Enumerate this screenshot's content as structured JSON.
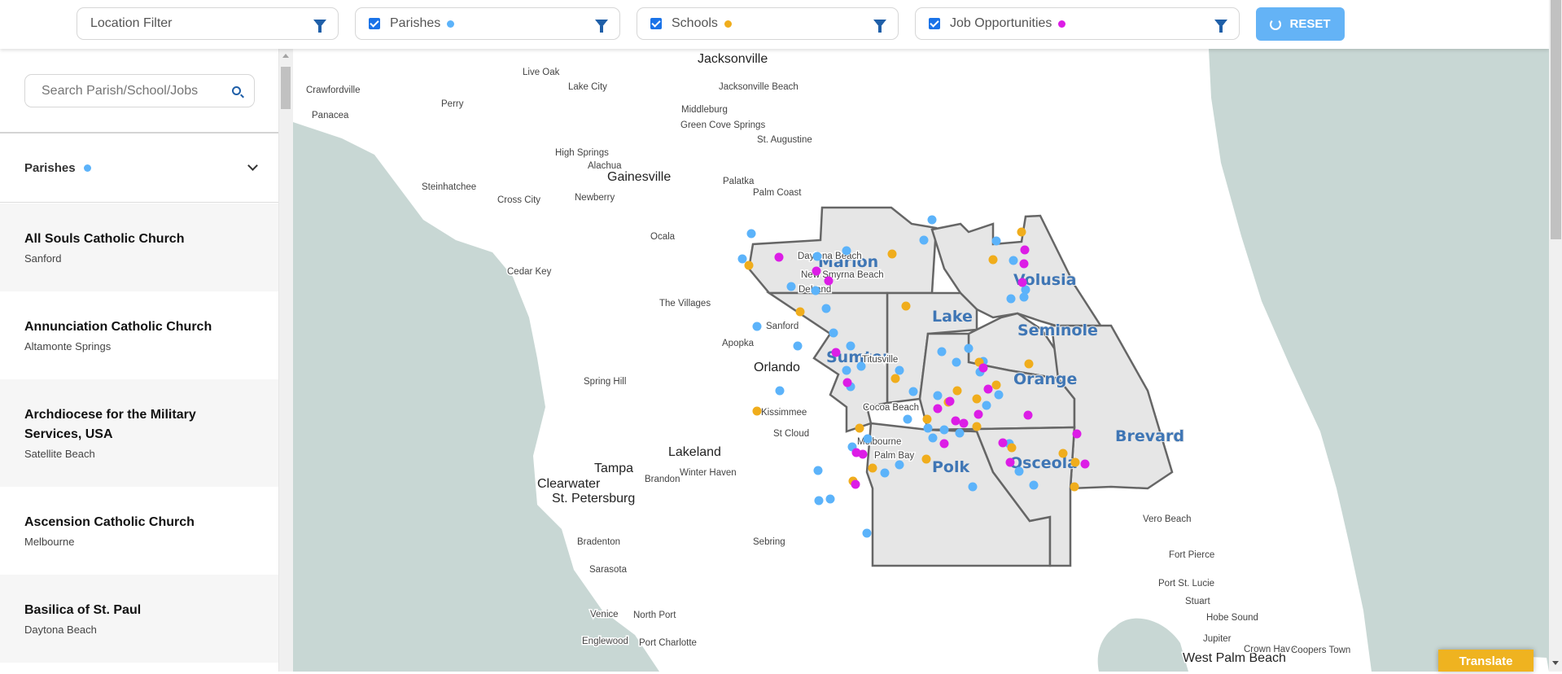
{
  "filters": {
    "location": {
      "label": "Location Filter"
    },
    "parishes": {
      "label": "Parishes",
      "checked": true,
      "color": "#5cb3fa"
    },
    "schools": {
      "label": "Schools",
      "checked": true,
      "color": "#f0ad1c"
    },
    "jobs": {
      "label": "Job Opportunities",
      "checked": true,
      "color": "#dc1de6"
    },
    "reset_label": "RESET"
  },
  "sidebar": {
    "search_placeholder": "Search Parish/School/Jobs",
    "section_title": "Parishes",
    "items": [
      {
        "name": "All Souls Catholic Church",
        "city": "Sanford"
      },
      {
        "name": "Annunciation Catholic Church",
        "city": "Altamonte Springs"
      },
      {
        "name": "Archdiocese for the Military Services, USA",
        "city": "Satellite Beach"
      },
      {
        "name": "Ascension Catholic Church",
        "city": "Melbourne"
      },
      {
        "name": "Basilica of St. Paul",
        "city": "Daytona Beach"
      }
    ]
  },
  "map": {
    "counties": [
      "Marion",
      "Volusia",
      "Lake",
      "Seminole",
      "Sumter",
      "Orange",
      "Brevard",
      "Polk",
      "Osceola"
    ],
    "cities": [
      "Jacksonville",
      "Live Oak",
      "Lake City",
      "Crawfordville",
      "Perry",
      "Panacea",
      "Middleburg",
      "Green Cove Springs",
      "Jacksonville Beach",
      "St. Augustine",
      "High Springs",
      "Alachua",
      "Gainesville",
      "Newberry",
      "Steinhatchee",
      "Cross City",
      "Palatka",
      "Palm Coast",
      "Cedar Key",
      "Ocala",
      "The Villages",
      "Daytona Beach",
      "New Smyrna Beach",
      "DeLand",
      "Sanford",
      "Apopka",
      "Orlando",
      "Titusville",
      "Spring Hill",
      "Kissimmee",
      "St Cloud",
      "Cocoa Beach",
      "Melbourne",
      "Palm Bay",
      "Lakeland",
      "Winter Haven",
      "Tampa",
      "Brandon",
      "Clearwater",
      "St. Petersburg",
      "Vero Beach",
      "Bradenton",
      "Sebring",
      "Fort Pierce",
      "Sarasota",
      "Port St. Lucie",
      "Stuart",
      "Venice",
      "North Port",
      "Hobe Sound",
      "Englewood",
      "Port Charlotte",
      "Jupiter",
      "West Palm Beach",
      "Crown Haven",
      "Coopers Town"
    ],
    "colors": {
      "water": "#c8d7d4",
      "land": "#ffffff",
      "region": "#e6e6e6",
      "border": "#666666"
    }
  },
  "translate_label": "Translate"
}
